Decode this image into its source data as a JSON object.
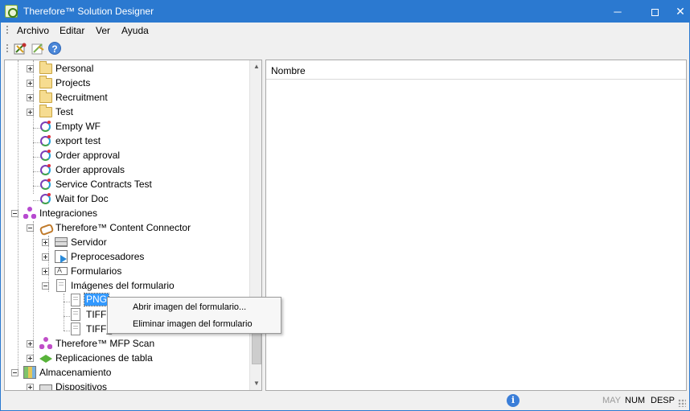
{
  "window": {
    "title": "Therefore™ Solution Designer",
    "controls": {
      "minimize": "─",
      "close": "✕"
    }
  },
  "menu": {
    "items": [
      {
        "label": "Archivo"
      },
      {
        "label": "Editar"
      },
      {
        "label": "Ver"
      },
      {
        "label": "Ayuda"
      }
    ]
  },
  "toolbar": {
    "help": "?"
  },
  "tree": {
    "nodes": [
      {
        "label": "Personal",
        "icon": "folder-icon",
        "expander": "plus"
      },
      {
        "label": "Projects",
        "icon": "folder-icon",
        "expander": "plus"
      },
      {
        "label": "Recruitment",
        "icon": "folder-icon",
        "expander": "plus"
      },
      {
        "label": "Test",
        "icon": "folder-icon",
        "expander": "plus"
      },
      {
        "label": "Empty WF",
        "icon": "workflow-icon"
      },
      {
        "label": "export test",
        "icon": "workflow-icon"
      },
      {
        "label": "Order approval",
        "icon": "workflow-icon"
      },
      {
        "label": "Order approvals",
        "icon": "workflow-icon"
      },
      {
        "label": "Service Contracts Test",
        "icon": "workflow-icon"
      },
      {
        "label": "Wait for Doc",
        "icon": "workflow-icon"
      },
      {
        "label": "Integraciones",
        "icon": "integrations-icon",
        "expander": "minus"
      },
      {
        "label": "Therefore™ Content Connector",
        "icon": "content-connector-icon",
        "expander": "minus"
      },
      {
        "label": "Servidor",
        "icon": "server-icon",
        "expander": "plus"
      },
      {
        "label": "Preprocesadores",
        "icon": "preprocessor-icon",
        "expander": "plus"
      },
      {
        "label": "Formularios",
        "icon": "form-icon",
        "expander": "plus"
      },
      {
        "label": "Imágenes del formulario",
        "icon": "form-image-icon",
        "expander": "minus"
      },
      {
        "label": "PNG",
        "icon": "image-file-icon",
        "selected": true
      },
      {
        "label": "TIFF",
        "icon": "image-file-icon"
      },
      {
        "label": "TIFF_",
        "icon": "image-file-icon"
      },
      {
        "label": "Therefore™ MFP Scan",
        "icon": "mfp-scan-icon",
        "expander": "plus"
      },
      {
        "label": "Replicaciones de tabla",
        "icon": "table-replication-icon",
        "expander": "plus"
      },
      {
        "label": "Almacenamiento",
        "icon": "storage-icon",
        "expander": "minus"
      },
      {
        "label": "Dispositivos",
        "icon": "device-icon",
        "expander": "plus"
      }
    ],
    "scroll": {
      "up": "▲",
      "down": "▼"
    }
  },
  "list": {
    "columns": [
      {
        "label": "Nombre"
      }
    ]
  },
  "context_menu": {
    "items": [
      {
        "label": "Abrir imagen del formulario..."
      },
      {
        "label": "Eliminar imagen del formulario"
      }
    ]
  },
  "status": {
    "info": "i",
    "may": "MAY",
    "num": "NUM",
    "desp": "DESP"
  },
  "colors": {
    "titlebar": "#2b79d0",
    "selection": "#3399ff"
  }
}
